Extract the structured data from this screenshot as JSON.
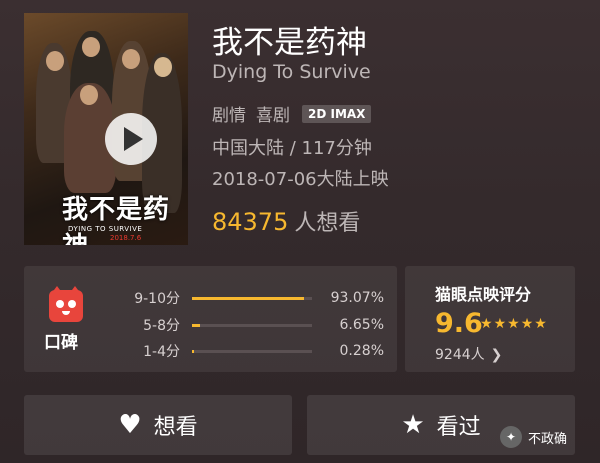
{
  "movie": {
    "title": "我不是药神",
    "title_en": "Dying To Survive",
    "genres": [
      "剧情",
      "喜剧"
    ],
    "format_badge": "2D IMAX",
    "region_duration": "中国大陆 / 117分钟",
    "release": "2018-07-06大陆上映",
    "wish_count": "84375",
    "wish_label": "人想看"
  },
  "poster": {
    "title_cn": "我不是药神",
    "title_en": "DYING TO SURVIVE",
    "date": "2018.7.6"
  },
  "koubei": {
    "label": "口碑",
    "distribution": [
      {
        "range": "9-10分",
        "percent": "93.07%",
        "fraction": 0.9307
      },
      {
        "range": "5-8分",
        "percent": "6.65%",
        "fraction": 0.0665
      },
      {
        "range": "1-4分",
        "percent": "0.28%",
        "fraction": 0.0028
      }
    ]
  },
  "score": {
    "title": "猫眼点映评分",
    "value": "9.6",
    "stars": 5,
    "count": "9244人"
  },
  "actions": {
    "want_label": "想看",
    "seen_label": "看过"
  },
  "watermark": {
    "text": "不政确"
  },
  "colors": {
    "accent": "#f7b82f",
    "koubei_red": "#e8453c"
  },
  "icons": {
    "play": "play-icon",
    "heart": "heart-icon",
    "star": "star-icon",
    "chevron": "chevron-right-icon"
  }
}
